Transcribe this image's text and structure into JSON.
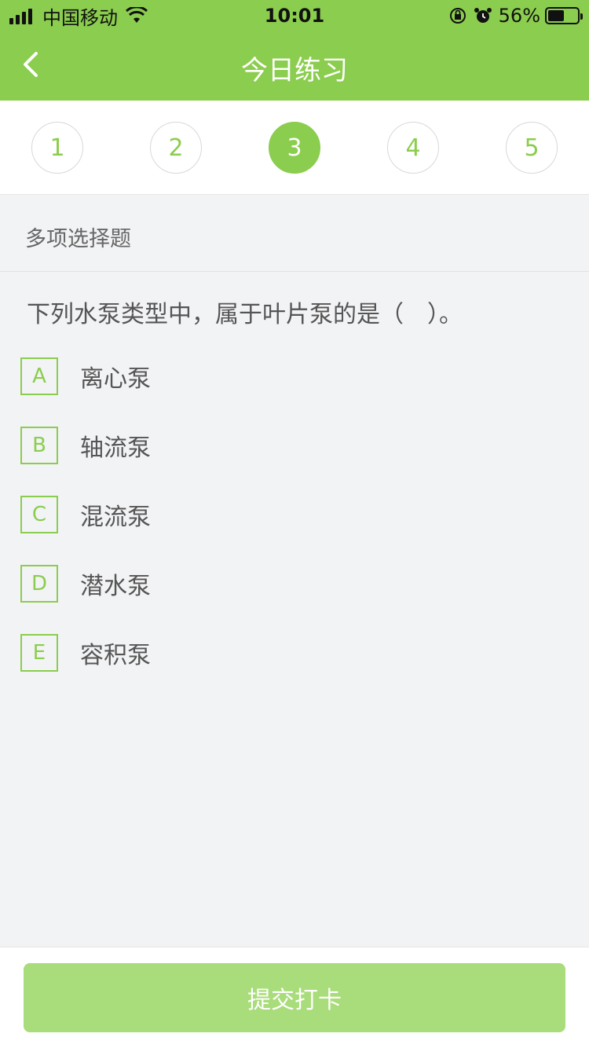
{
  "status_bar": {
    "carrier": "中国移动",
    "time": "10:01",
    "battery_percent": "56%",
    "battery_level": 0.56,
    "icons": [
      "signal-icon",
      "wifi-icon",
      "rotation-lock-icon",
      "alarm-icon",
      "battery-icon"
    ]
  },
  "nav": {
    "title": "今日练习",
    "back_icon": "chevron-left-icon"
  },
  "steps": {
    "items": [
      "1",
      "2",
      "3",
      "4",
      "5"
    ],
    "active_index": 2
  },
  "question": {
    "type_label": "多项选择题",
    "text": "下列水泵类型中，属于叶片泵的是（　）。",
    "options": [
      {
        "key": "A",
        "text": "离心泵"
      },
      {
        "key": "B",
        "text": "轴流泵"
      },
      {
        "key": "C",
        "text": "混流泵"
      },
      {
        "key": "D",
        "text": "潜水泵"
      },
      {
        "key": "E",
        "text": "容积泵"
      }
    ]
  },
  "footer": {
    "submit_label": "提交打卡"
  },
  "colors": {
    "accent": "#8bcd4e",
    "button_disabled": "#a9dc7a",
    "background": "#f2f3f5"
  }
}
